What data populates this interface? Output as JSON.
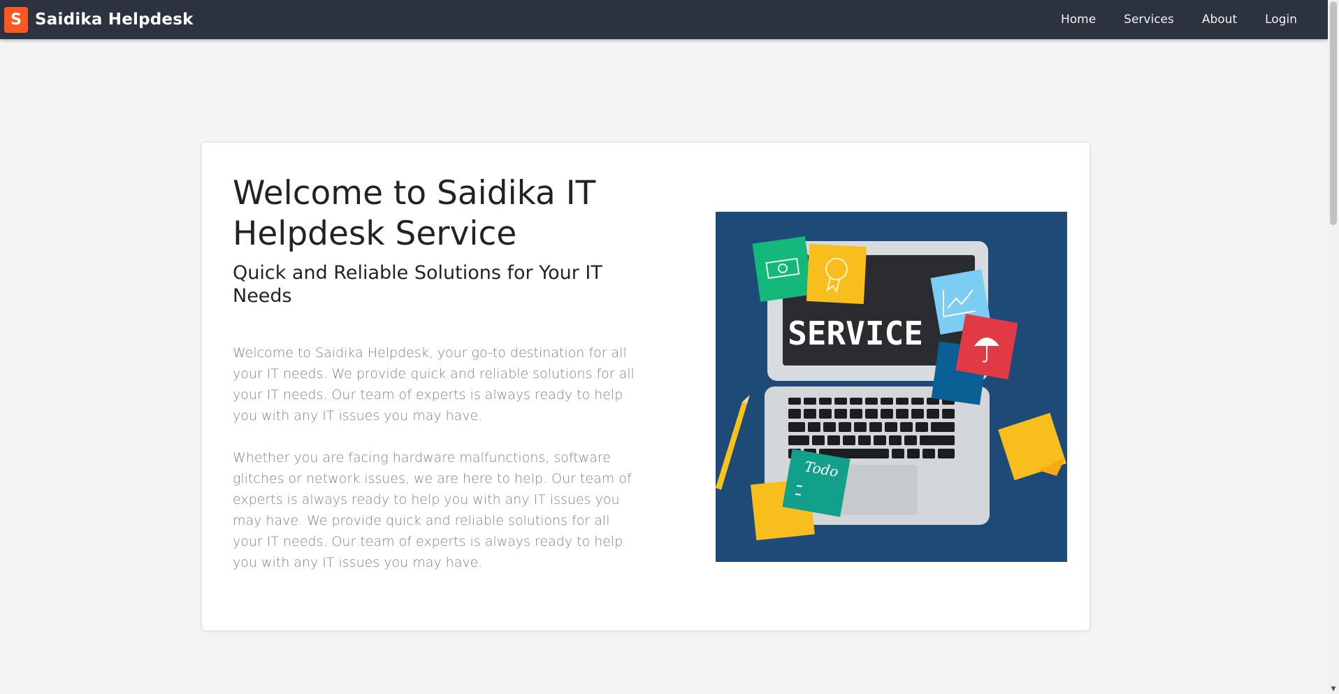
{
  "navbar": {
    "logo_letter": "S",
    "brand": "Saidika Helpdesk",
    "links": [
      "Home",
      "Services",
      "About",
      "Login"
    ]
  },
  "hero": {
    "title": "Welcome to Saidika IT Helpdesk Service",
    "subtitle": "Quick and Reliable Solutions for Your IT Needs",
    "paragraphs": [
      "Welcome to Saidika Helpdesk, your go-to destination for all your IT needs. We provide quick and reliable solutions for all your IT needs. Our team of experts is always ready to help you with any IT issues you may have.",
      "Whether you are facing hardware malfunctions, software glitches or network issues, we are here to help. Our team of experts is always ready to help you with any IT issues you may have. We provide quick and reliable solutions for all your IT needs. Our team of experts is always ready to help you with any IT issues you may have."
    ],
    "image": {
      "screen_text": "SERVICE",
      "note_text": "Todo"
    }
  },
  "colors": {
    "navbar_bg": "#2c323e",
    "brand_accent": "#ff5722",
    "page_bg": "#f4f4f4",
    "image_bg": "#1e4a78"
  }
}
